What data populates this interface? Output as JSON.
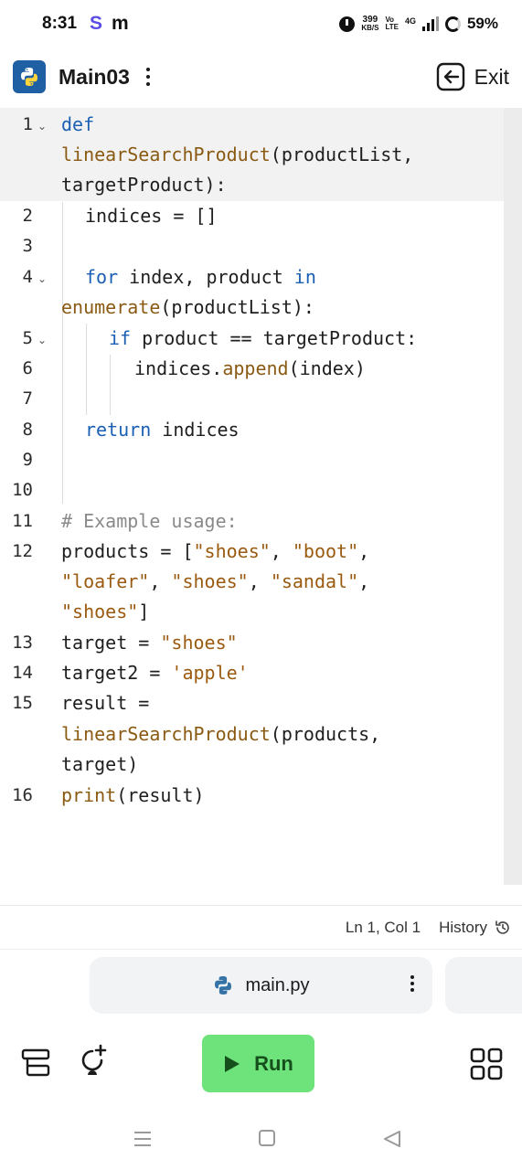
{
  "status_bar": {
    "time": "8:31",
    "app_icon_1": "S",
    "app_icon_2": "m",
    "speed_value": "399",
    "speed_unit": "KB/S",
    "volte_line1": "Vo",
    "volte_line2": "LTE",
    "network": "4G",
    "battery": "59%"
  },
  "header": {
    "title": "Main03",
    "exit_label": "Exit"
  },
  "editor": {
    "line_numbers": [
      "1",
      "2",
      "3",
      "4",
      "5",
      "6",
      "7",
      "8",
      "9",
      "10",
      "11",
      "12",
      "13",
      "14",
      "15",
      "16"
    ],
    "tokens": {
      "def": "def",
      "fn_name": "linearSearchProduct",
      "params": "(productList,",
      "params2": "targetProduct):",
      "indices_init": "indices = []",
      "for": "for",
      "for_vars": " index, product ",
      "in": "in",
      "enumerate": "enumerate",
      "enumerate_args": "(productList):",
      "if": "if",
      "if_cond": " product == targetProduct:",
      "append_obj": "indices.",
      "append": "append",
      "append_args": "(index)",
      "return": "return",
      "return_val": " indices",
      "comment": "# Example usage:",
      "products_assign": "products = [",
      "s_shoes": "\"shoes\"",
      "s_boot": "\"boot\"",
      "s_loafer": "\"loafer\"",
      "s_sandal": "\"sandal\"",
      "comma": ", ",
      "comma_end": ",",
      "close_bracket": "]",
      "target_assign": "target = ",
      "target2_assign": "target2 = ",
      "s_apple": "'apple'",
      "result_assign": "result =",
      "call_args": "(products,",
      "call_args2": "target)",
      "print": "print",
      "print_args": "(result)"
    }
  },
  "editor_status": {
    "cursor": "Ln 1, Col 1",
    "history_label": "History"
  },
  "file_tab": {
    "name": "main.py"
  },
  "toolbar": {
    "run_label": "Run"
  },
  "colors": {
    "run_button": "#6fe37b",
    "keyword": "#1a5fb4",
    "string": "#9a5a10",
    "comment": "#8a8a8a"
  }
}
